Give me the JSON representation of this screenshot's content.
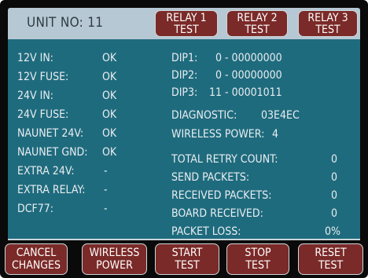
{
  "header": {
    "unit_label": "UNIT NO: 11",
    "buttons": [
      {
        "line1": "RELAY 1",
        "line2": "TEST"
      },
      {
        "line1": "RELAY 2",
        "line2": "TEST"
      },
      {
        "line1": "RELAY 3",
        "line2": "TEST"
      }
    ]
  },
  "status": {
    "left": [
      {
        "label": "12V IN:",
        "value": "OK"
      },
      {
        "label": "12V FUSE:",
        "value": "OK"
      },
      {
        "label": "24V IN:",
        "value": "OK"
      },
      {
        "label": "24V FUSE:",
        "value": "OK"
      },
      {
        "label": "NAUNET 24V:",
        "value": "OK"
      },
      {
        "label": "NAUNET GND:",
        "value": "OK"
      },
      {
        "label": "EXTRA 24V:",
        "value": "-"
      },
      {
        "label": "EXTRA RELAY:",
        "value": "-"
      },
      {
        "label": "DCF77:",
        "value": "-"
      }
    ],
    "dips": [
      {
        "label": "DIP1:",
        "value": "0 - 00000000"
      },
      {
        "label": "DIP2:",
        "value": "0 - 00000000"
      },
      {
        "label": "DIP3:",
        "value": "11 - 00001011"
      }
    ],
    "diagnostic": {
      "label": "DIAGNOSTIC:",
      "value": "03E4EC"
    },
    "wireless_power": {
      "label": "WIRELESS POWER:",
      "value": "4"
    },
    "counters": [
      {
        "label": "TOTAL RETRY COUNT:",
        "value": "0"
      },
      {
        "label": "SEND PACKETS:",
        "value": "0"
      },
      {
        "label": "RECEIVED PACKETS:",
        "value": "0"
      },
      {
        "label": "BOARD RECEIVED:",
        "value": "0"
      },
      {
        "label": "PACKET LOSS:",
        "value": "0%"
      }
    ]
  },
  "footer": {
    "buttons": [
      {
        "line1": "CANCEL",
        "line2": "CHANGES"
      },
      {
        "line1": "WIRELESS",
        "line2": "POWER"
      },
      {
        "line1": "START",
        "line2": "TEST"
      },
      {
        "line1": "STOP",
        "line2": "TEST"
      },
      {
        "line1": "RESET",
        "line2": "TEST"
      }
    ]
  },
  "colors": {
    "header_bg": "#b6c8d3",
    "panel_bg": "#1f6b7e",
    "button_bg": "#7a2a28",
    "frame": "#0a0a0a"
  }
}
